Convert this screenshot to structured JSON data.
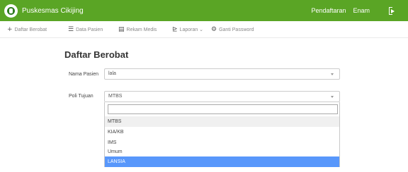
{
  "topbar": {
    "brand": "Puskesmas Cikijing",
    "links": [
      "Pendaftaran",
      "Enam"
    ],
    "logout_icon": "logout-icon",
    "color": "#5aa525"
  },
  "nav": {
    "items": [
      {
        "label": "Daftar Berobat",
        "icon": "+"
      },
      {
        "label": "Data Pasien",
        "icon": "☰"
      },
      {
        "label": "Rekam Medis",
        "icon": "▤"
      },
      {
        "label": "Laporan ⌄",
        "icon": "⊵"
      },
      {
        "label": "Ganti Password",
        "icon": "⚙"
      }
    ]
  },
  "page": {
    "title": "Daftar Berobat"
  },
  "form": {
    "patient_label": "Nama Pasien",
    "patient_value": "lala",
    "poli_label": "Poli Tujuan",
    "poli_value": "MTBS"
  },
  "dropdown": {
    "search_value": "",
    "options": [
      "MTBS",
      "KIA/KB",
      "IMS",
      "Umum",
      "LANSIA"
    ],
    "highlighted": "LANSIA",
    "highlight_color": "#5897fb"
  }
}
